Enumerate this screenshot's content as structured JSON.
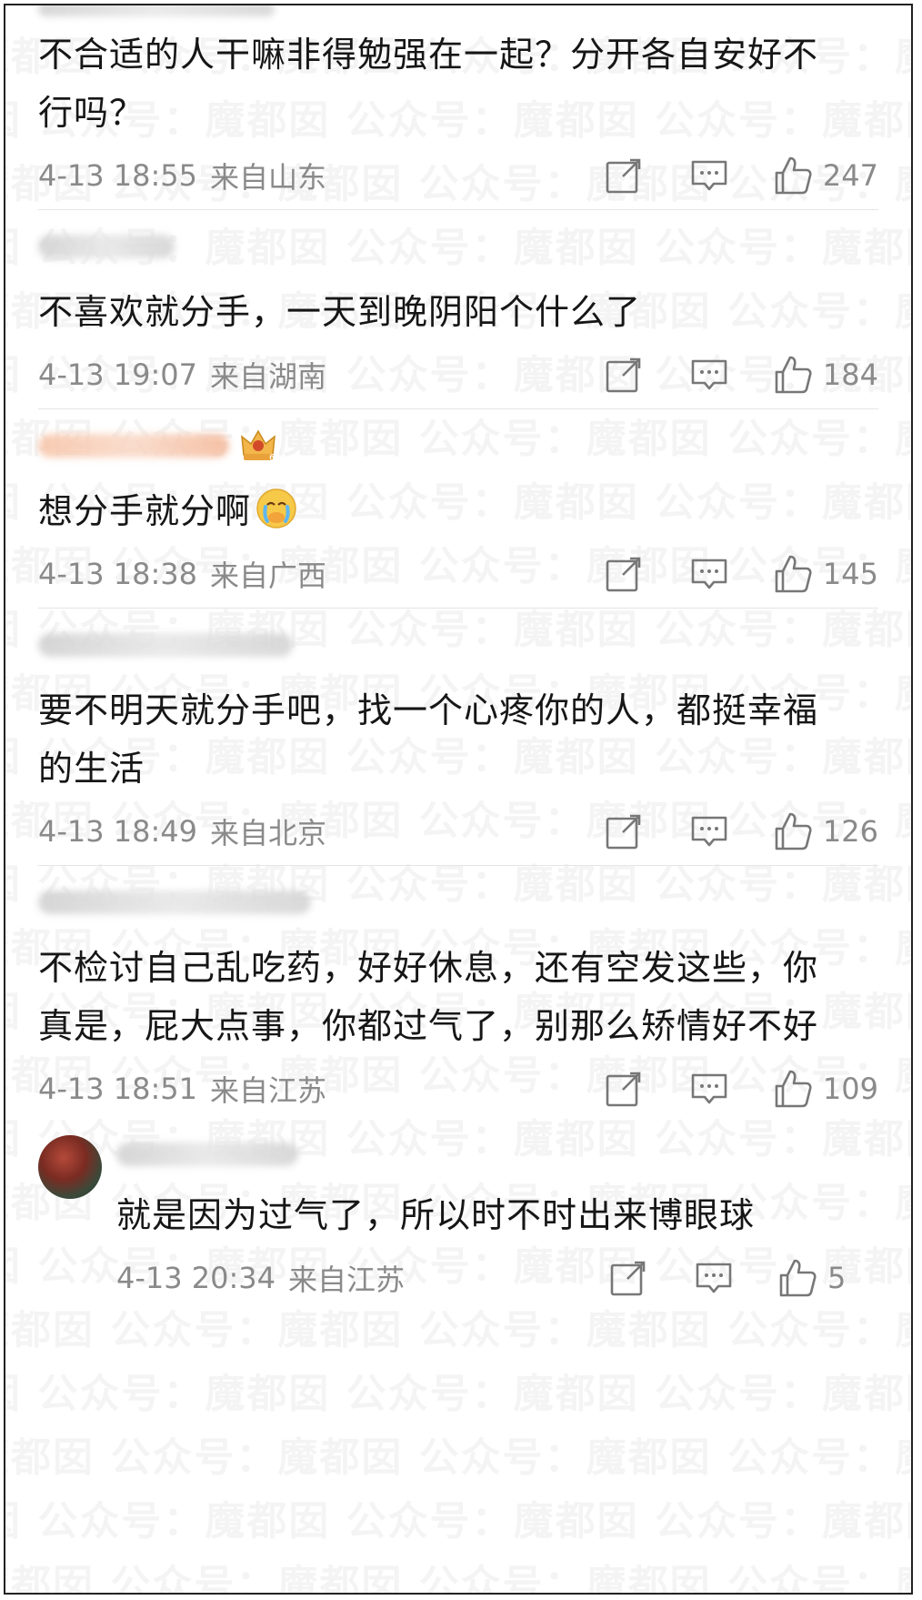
{
  "comments": [
    {
      "text": "不合适的人干嘛非得勉强在一起？分开各自安好不行吗？",
      "time": "4-13 18:55",
      "location": "来自山东",
      "likes": "247"
    },
    {
      "text": "不喜欢就分手，一天到晚阴阳个什么了",
      "time": "4-13 19:07",
      "location": "来自湖南",
      "likes": "184"
    },
    {
      "text": "想分手就分啊",
      "emoji": "crying-face-emoji",
      "badge": "crown-level-6-badge",
      "time": "4-13 18:38",
      "location": "来自广西",
      "likes": "145"
    },
    {
      "text": "要不明天就分手吧，找一个心疼你的人，都挺幸福的生活",
      "time": "4-13 18:49",
      "location": "来自北京",
      "likes": "126"
    },
    {
      "text": "不检讨自己乱吃药，好好休息，还有空发这些，你真是，屁大点事，你都过气了，别那么矫情好不好",
      "time": "4-13 18:51",
      "location": "来自江苏",
      "likes": "109"
    }
  ],
  "reply": {
    "text": "就是因为过气了，所以时不时出来博眼球",
    "time": "4-13 20:34",
    "location": "来自江苏",
    "likes": "5"
  },
  "watermark_text": "魔都囡  公众号：魔都囡  公众号：魔都囡  公众号：魔都囡",
  "icons": [
    "share-icon",
    "comment-icon",
    "like-icon"
  ],
  "colors": {
    "text": "#161616",
    "meta": "#8a8a8a",
    "divider": "#e5e5e5"
  }
}
